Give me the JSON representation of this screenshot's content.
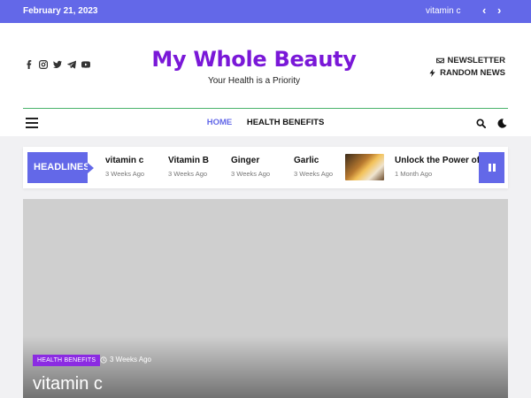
{
  "topbar": {
    "date": "February 21, 2023",
    "trending": "vitamin c",
    "prev_label": "‹",
    "next_label": "›"
  },
  "header": {
    "title": "My Whole Beauty",
    "tagline": "Your Health is a Priority",
    "title_color": "#7a18d8",
    "social_icons": [
      "facebook-icon",
      "instagram-icon",
      "twitter-icon",
      "telegram-icon",
      "youtube-icon"
    ],
    "newsletter_label": "NEWSLETTER",
    "random_label": "RANDOM NEWS"
  },
  "nav": {
    "items": [
      {
        "label": "HOME",
        "active": true
      },
      {
        "label": "HEALTH BENEFITS",
        "active": false
      }
    ],
    "accent": "#6368e8"
  },
  "ticker": {
    "label": "HEADLINES",
    "items": [
      {
        "title": "vitamin c",
        "meta": "3 Weeks Ago"
      },
      {
        "title": "Vitamin B",
        "meta": "3 Weeks Ago"
      },
      {
        "title": "Ginger",
        "meta": "3 Weeks Ago"
      },
      {
        "title": "Garlic",
        "meta": "3 Weeks Ago"
      },
      {
        "title": "Unlock the Power of Na",
        "meta": "1 Month Ago"
      }
    ]
  },
  "hero": {
    "category": "HEALTH BENEFITS",
    "time": "3 Weeks Ago",
    "title": "vitamin c",
    "category_color": "#8b2be2"
  }
}
